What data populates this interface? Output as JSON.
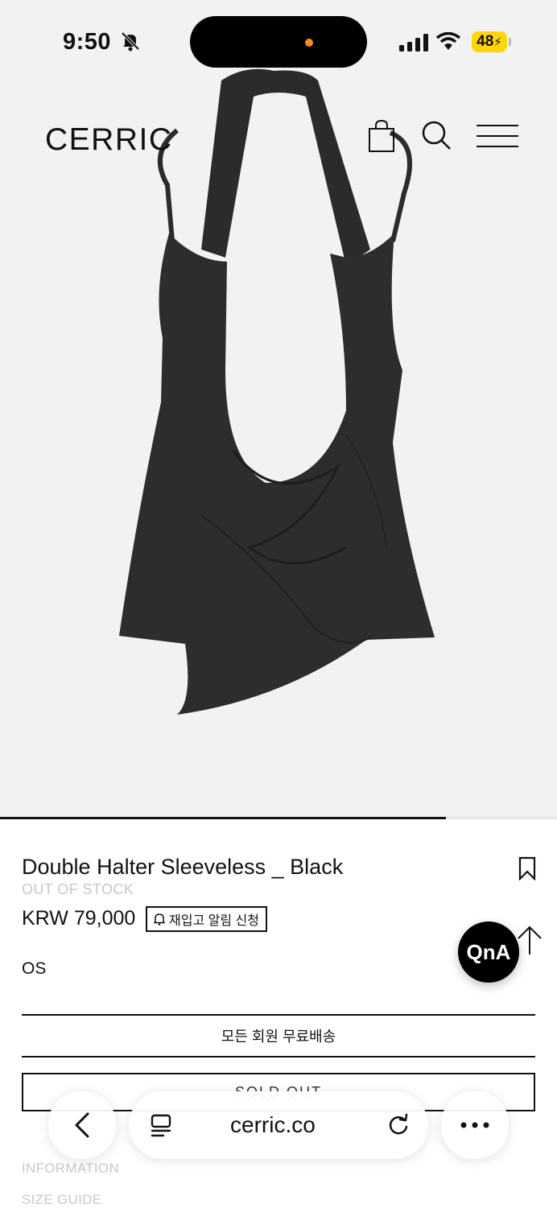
{
  "status_bar": {
    "time": "9:50",
    "battery": "48"
  },
  "header": {
    "logo": "CERRIC"
  },
  "product": {
    "title": "Double Halter Sleeveless _ Black",
    "stock_status": "OUT OF STOCK",
    "price": "KRW 79,000",
    "restock_button_label": "재입고 알림 신청",
    "option": "OS",
    "shipping_notice": "모든 회원 무료배송",
    "soldout_label": "SOLD OUT"
  },
  "floating": {
    "qna_label": "QnA"
  },
  "tabs": {
    "information": "INFORMATION",
    "size_guide": "SIZE GUIDE"
  },
  "gallery": {
    "progress": 0.8
  },
  "browser": {
    "url": "cerric.co"
  },
  "icons": {
    "bag": "shopping-bag-icon",
    "search": "search-icon",
    "menu": "hamburger-menu-icon",
    "bookmark": "bookmark-icon",
    "bell": "bell-icon",
    "back": "chevron-left-icon",
    "tabs": "reader-icon",
    "reload": "reload-icon",
    "more": "ellipsis-icon"
  },
  "colors": {
    "hero_bg": "#f2f2f2",
    "stock_gray": "#c8c8c8",
    "battery": "#ffd60a",
    "island_dot": "#ff8a1e"
  }
}
